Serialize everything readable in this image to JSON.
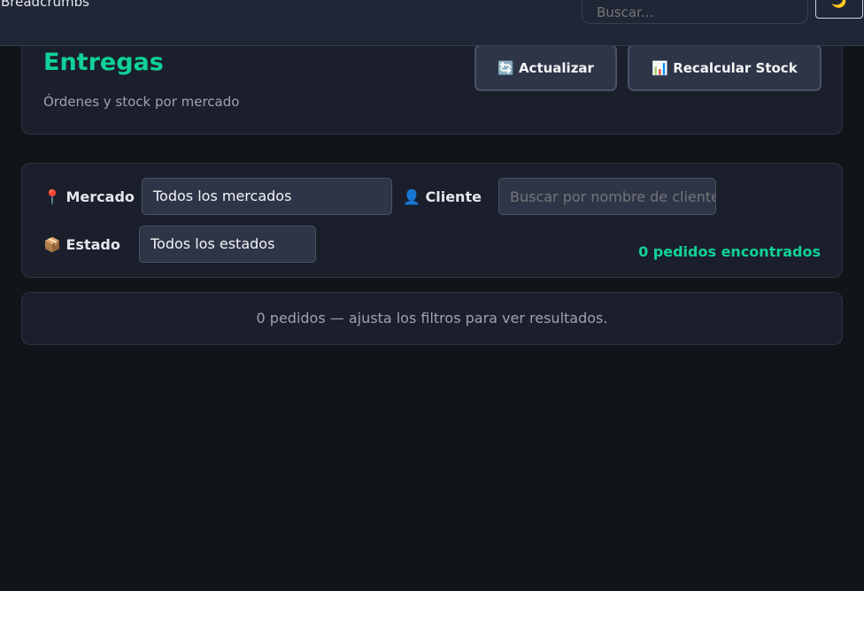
{
  "topbar": {
    "breadcrumbs": "Breadcrumbs",
    "search_placeholder": "Buscar...",
    "theme_icon": "🌙"
  },
  "header": {
    "title": "Entregas",
    "subtitle": "Órdenes y stock por mercado",
    "refresh_label": "🔄 Actualizar",
    "recalc_label": "📊 Recalcular Stock"
  },
  "filters": {
    "market_label": "📍 Mercado",
    "market_value": "Todos los mercados",
    "client_label": "👤 Cliente",
    "client_placeholder": "Buscar por nombre de cliente",
    "status_label": "📦 Estado",
    "status_value": "Todos los estados",
    "count": "0 pedidos encontrados"
  },
  "empty": "0 pedidos — ajusta los filtros para ver resultados.",
  "colors": {
    "accent": "#10d19a",
    "background": "#111418",
    "card": "#1a1f2b"
  }
}
